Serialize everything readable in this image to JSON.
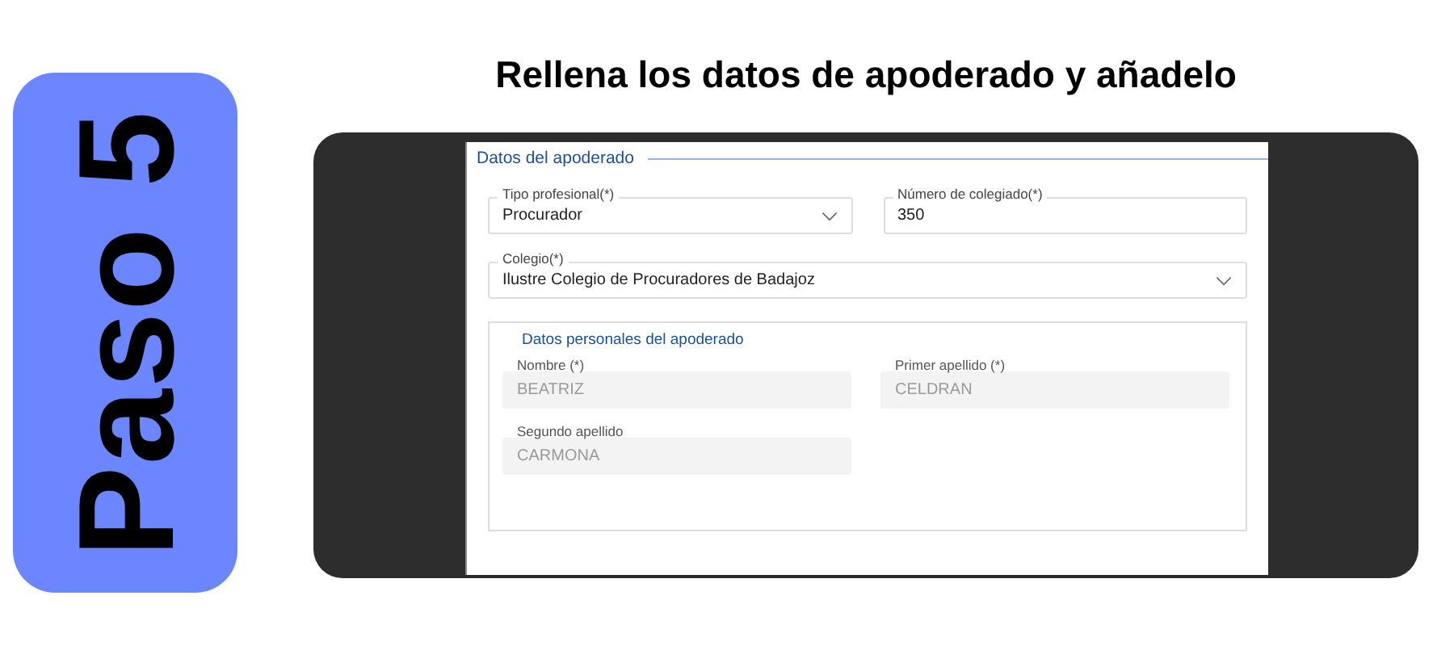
{
  "step_badge": {
    "text": "Paso 5"
  },
  "heading": "Rellena los datos de apoderado y añadelo",
  "form": {
    "section_title": "Datos del apoderado",
    "rows": [
      [
        {
          "kind": "select",
          "label": "Tipo profesional(*)",
          "value": "Procurador",
          "disabled": false
        },
        {
          "kind": "text",
          "label": "Número de colegiado(*)",
          "value": "350",
          "disabled": false
        }
      ],
      [
        {
          "kind": "select",
          "label": "Colegio(*)",
          "value": "Ilustre Colegio de Procuradores de Badajoz",
          "disabled": false
        }
      ]
    ],
    "subsection": {
      "title": "Datos personales del apoderado",
      "rows": [
        [
          {
            "kind": "text",
            "label": "Nombre (*)",
            "value": "BEATRIZ",
            "disabled": true
          },
          {
            "kind": "text",
            "label": "Primer apellido (*)",
            "value": "CELDRAN",
            "disabled": true
          }
        ],
        [
          {
            "kind": "text",
            "label": "Segundo apellido",
            "value": "CARMONA",
            "disabled": true
          }
        ]
      ]
    }
  }
}
